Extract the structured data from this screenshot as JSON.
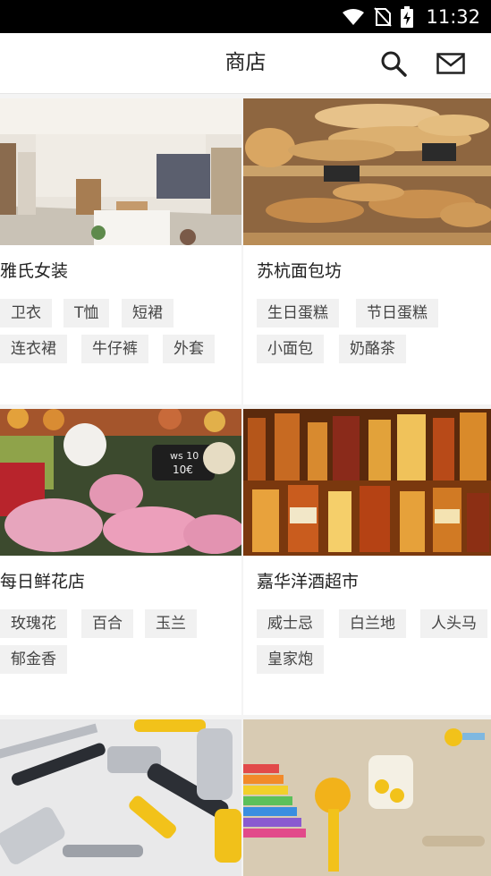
{
  "status_bar": {
    "time": "11:32"
  },
  "app_bar": {
    "title": "商店"
  },
  "shops": [
    {
      "name": "雅氏女装",
      "tags": [
        "卫衣",
        "T恤",
        "短裙",
        "连衣裙",
        "牛仔裤",
        "外套"
      ]
    },
    {
      "name": "苏杭面包坊",
      "tags": [
        "生日蛋糕",
        "节日蛋糕",
        "小面包",
        "奶酪茶"
      ]
    },
    {
      "name": "每日鲜花店",
      "tags": [
        "玫瑰花",
        "百合",
        "玉兰",
        "郁金香"
      ]
    },
    {
      "name": "嘉华洋酒超市",
      "tags": [
        "威士忌",
        "白兰地",
        "人头马",
        "皇家炮"
      ]
    },
    {
      "name": "",
      "tags": []
    },
    {
      "name": "",
      "tags": []
    }
  ]
}
